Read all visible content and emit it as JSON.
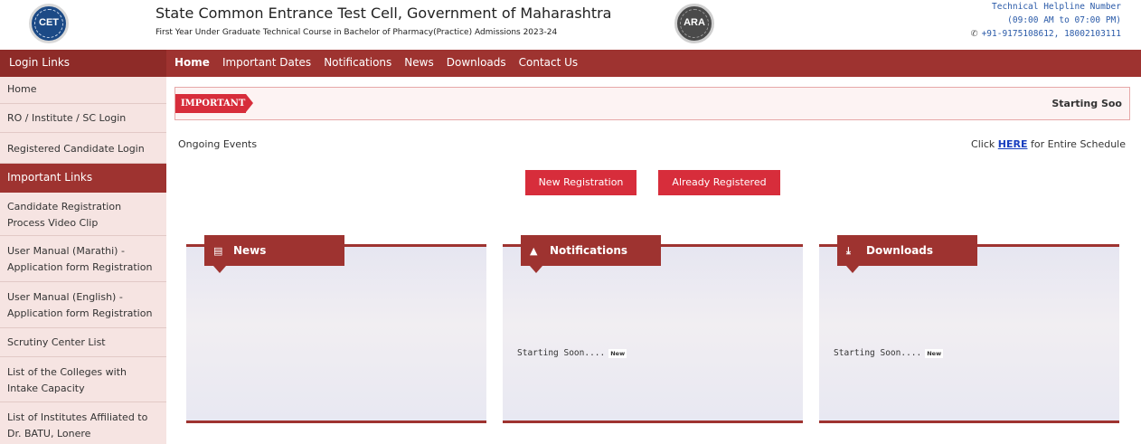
{
  "header": {
    "title": "State Common Entrance Test Cell, Government of Maharashtra",
    "subtitle": "First Year Under Graduate Technical Course in Bachelor of Pharmacy(Practice) Admissions 2023-24",
    "logo_left_text": "CET",
    "logo_right_text": "ARA",
    "helpline_label": "Technical Helpline Number",
    "helpline_hours": "(09:00 AM to 07:00 PM)",
    "helpline_numbers": "+91-9175108612, 18002103111"
  },
  "nav": {
    "left_title": "Login Links",
    "items": [
      "Home",
      "Important Dates",
      "Notifications",
      "News",
      "Downloads",
      "Contact Us"
    ]
  },
  "sidebar": {
    "login_items": [
      "Home",
      "RO / Institute / SC Login",
      "Registered Candidate Login"
    ],
    "important_title": "Important Links",
    "important_items": [
      [
        "Candidate Registration",
        "Process Video Clip"
      ],
      [
        "User Manual (Marathi) -",
        "Application form Registration"
      ],
      [
        "User Manual (English) -",
        "Application form Registration"
      ],
      [
        "Scrutiny Center List"
      ],
      [
        "List of the Colleges with",
        "Intake Capacity"
      ],
      [
        "List of Institutes Affiliated to",
        "Dr. BATU, Lonere"
      ]
    ]
  },
  "ticker": {
    "badge": "IMPORTANT",
    "text": "Starting Soo"
  },
  "main": {
    "ongoing": "Ongoing Events",
    "schedule_prefix": "Click",
    "schedule_link": "HERE",
    "schedule_suffix": "for Entire Schedule",
    "btn_new": "New Registration",
    "btn_registered": "Already Registered"
  },
  "panels": {
    "news": {
      "title": "News",
      "icon": "newspaper-icon",
      "text": "",
      "badge": ""
    },
    "notifications": {
      "title": "Notifications",
      "icon": "bell-icon",
      "text": "Starting Soon....",
      "badge": "New"
    },
    "downloads": {
      "title": "Downloads",
      "icon": "download-icon",
      "text": "Starting Soon....",
      "badge": "New"
    }
  },
  "colors": {
    "brand": "#9e3330",
    "accent": "#d72d3b",
    "sidebar_bg": "#f6e4e2",
    "link": "#1a3fbf"
  }
}
